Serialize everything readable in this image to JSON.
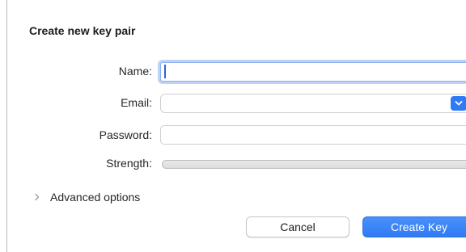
{
  "dialog": {
    "title": "Create new key pair"
  },
  "form": {
    "name_label": "Name:",
    "name_value": "",
    "email_label": "Email:",
    "email_value": "",
    "password_label": "Password:",
    "password_value": "",
    "strength_label": "Strength:",
    "strength_level": 0
  },
  "advanced": {
    "label": "Advanced options",
    "expanded": false
  },
  "buttons": {
    "cancel": "Cancel",
    "create": "Create Key"
  },
  "colors": {
    "accent": "#2f7bf5",
    "focus_ring": "#bcd3f6"
  },
  "icons": {
    "disclosure": "chevron-right-icon",
    "email_popup": "chevron-down-icon"
  }
}
